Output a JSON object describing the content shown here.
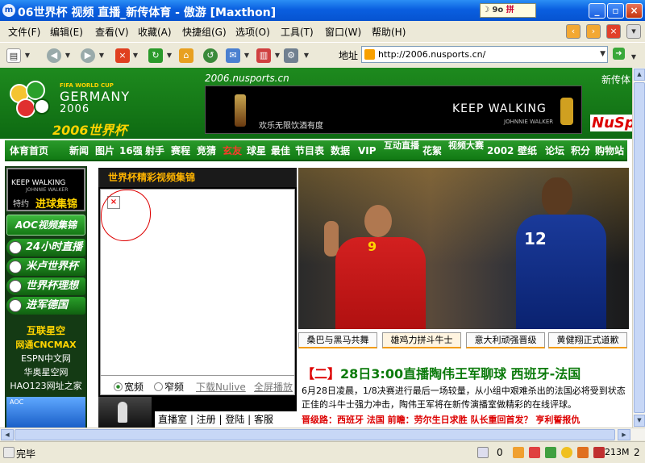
{
  "window": {
    "title": "06世界杯 视频 直播_新传体育 - 傲游 [Maxthon]",
    "app_icon": "m",
    "tray_text": "9o",
    "tray_pin": "拼",
    "btn_min": "_",
    "btn_max": "▫",
    "btn_close": "×"
  },
  "menu": [
    "文件(F)",
    "编辑(E)",
    "查看(V)",
    "收藏(A)",
    "快捷组(G)",
    "选项(O)",
    "工具(T)",
    "窗口(W)",
    "帮助(H)"
  ],
  "address": {
    "label": "地址",
    "url": "http://2006.nusports.cn/"
  },
  "header": {
    "fifa_text": "FIFA WORLD CUP",
    "country": "GERMANY",
    "year": "2006",
    "worldcup_title": "2006世界杯",
    "site_url": "2006.nusports.cn",
    "banner_slogan": "欢乐无限饮酒有度",
    "banner_keep_walking": "KEEP WALKING",
    "banner_brand": "JOHNNIE WALKER",
    "top_right": "新传体",
    "nusp_logo": "NuSp"
  },
  "nav": [
    {
      "label": "体育首页"
    },
    {
      "label": "新闻"
    },
    {
      "label": "图片"
    },
    {
      "label": "16强"
    },
    {
      "label": "射手"
    },
    {
      "label": "赛程"
    },
    {
      "label": "竞猜"
    },
    {
      "label": "玄友",
      "red": true
    },
    {
      "label": "球星"
    },
    {
      "label": "最佳"
    },
    {
      "label": "节目表"
    },
    {
      "label": "数据"
    },
    {
      "label": "VIP"
    },
    {
      "label": "互动直播"
    },
    {
      "label": "花絮"
    },
    {
      "label": "视频大赛"
    },
    {
      "label": "2002"
    },
    {
      "label": "壁纸"
    },
    {
      "label": "论坛"
    },
    {
      "label": "积分"
    },
    {
      "label": "购物站"
    }
  ],
  "left": {
    "ad_keep_walking": "KEEP WALKING",
    "ad_brand": "JOHNNIE WALKER",
    "ad_sponsor": "特约",
    "ad_highlight": "进球集锦",
    "aoc_button": "AOC视频集锦",
    "buttons": [
      "24小时直播",
      "米卢世界杯",
      "世界杯理想",
      "进军德国"
    ],
    "link_title1": "互联星空",
    "link_title2": "网通CNCMAX",
    "links": [
      "ESPN中文网",
      "华奥星空网",
      "HAO123网址之家"
    ],
    "ad2_text": "AOC"
  },
  "video": {
    "header": "世界杯精彩视频集锦",
    "broken_icon": "×",
    "opt_wide": "宽频",
    "opt_narrow": "窄频",
    "download": "下载Nulive",
    "fullscreen": "全屏播放",
    "bottom_links": "直播室 | 注册 | 登陆 | 客服"
  },
  "tabs": [
    "桑巴与黑马共舞",
    "雄鸡力拼斗牛士",
    "意大利顽强晋级",
    "黄健翔正式道歉"
  ],
  "story": {
    "headline_prefix": "【二】",
    "headline_time": "28日3:00",
    "headline_text": "直播陶伟王军聊球 西班牙-法国",
    "body": "6月28日凌晨，1/8决赛进行最后一场较量，从小组中艰难杀出的法国必将受到状态正佳的斗牛士强力冲击，陶伟王军将在新传演播室做精彩的在线评球。",
    "red_line": "晋级路：西班牙 法国 前瞻：劳尔生日求胜 队长重回首发？ 亨利誓报仇"
  },
  "photo": {
    "player1_number": "9",
    "player2_number": "12"
  },
  "status": {
    "text": "完毕",
    "count": "0",
    "memory": "213M",
    "windows": "2"
  }
}
